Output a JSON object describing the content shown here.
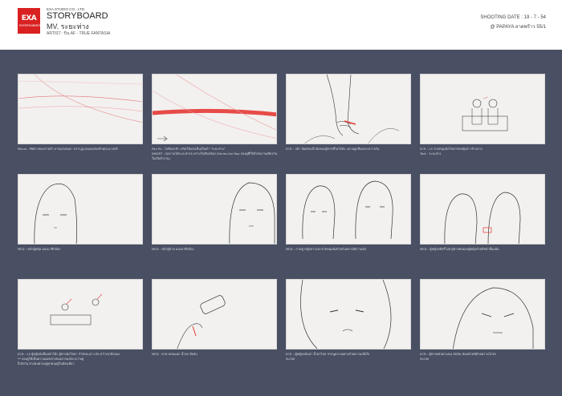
{
  "header": {
    "logo_text": "EXA",
    "logo_sub": "ENTERTAINMENT",
    "company": "EXA STUDIO CO., LTD.",
    "title": "STORYBOARD",
    "subtitle": "MV. ระยะห่าง",
    "artist": "ARTIST : ปิ่น AF - TRUE FANTASIA",
    "shooting_date": "SHOOTING DATE : 19 - 7 - 54",
    "location": "@ PAPAYA  ลาดพร้าว 55/1"
  },
  "panels": [
    {
      "caption": "Macro : ทิศทางของสายฟ้า สาดแสงลงมา ปรากฏแสงแดงส่องทั่วทุกแนวปกติ"
    },
    {
      "caption": "Pan Rt : ไปที่แสงฟ้า เสริมให้แสงเห็นเป็นคำ \"ระยะห่าง\"\nINSERT : ทุกภาพได้ระยะห่างระหว่างใจเรียบร้อย (Series Ani Rep ลองดูที่ใช้ลำดับภาพเดียวกันในเริ่มทำงาน)"
    },
    {
      "caption": "ECR : ปลิว สัมผัสลงนิ้วมือของผู้ชายที่ไม่ได้จับ แหวนผูกสีแดงระหว่างกัน"
    },
    {
      "caption": "ECR : LS ชายหนุ่มนั่งโซฟากับหญิงสาวข้างกาย\nText : ระยะห่าง"
    },
    {
      "caption": "MED : หน้าผู้หญิง มองมาที่กล้อง"
    },
    {
      "caption": "MED : หน้าผู้ชาย มองมาที่กล้อง"
    },
    {
      "caption": "MED : ภาพคู่ หญิงสาวและชายหนุ่มนั่งด้วยกันอย่างมีความสุข"
    },
    {
      "caption": "MED : ผู้หญิงหยิบรีโมท ผู้ชายหันมองผู้หญิงด้วยสีหน้ายิ้มแย้ม"
    },
    {
      "caption": "ECR : LS ผู้หญิงนั่งพื้นหน้าโต๊ะ ผู้ชายนั่งโซฟา กำลังทะเลาะกัน ขว้างปาสิ่งของ\n** ลองดูให้เห็นความแตกต่างของอารมณ์ระหว่างคู่\nก็เลิกกัน ต่างคนต่างอยู่ทุกคนอยู่ในห้องเดียว"
    },
    {
      "caption": "MED : ขวด หล่นแตก น้ำหก มือจับ"
    },
    {
      "caption": "ECR : ผู้หญิงหลับตา น้ำตาไหล ปากพูดบางอย่างด้วยความเสียใจ\nSLOW"
    },
    {
      "caption": "ECR : ผู้ชายหลับตาแน่น กัดฟัน หันหน้าหนีด้วยความโกรธ\nSLOW"
    }
  ]
}
